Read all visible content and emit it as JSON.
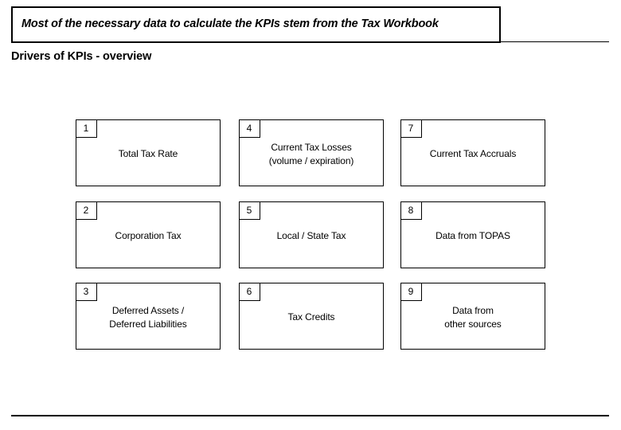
{
  "slide": {
    "title": "Most of the necessary data to calculate the KPIs stem from the Tax Workbook",
    "subtitle": "Drivers of KPIs - overview"
  },
  "grid": {
    "columns": 3,
    "rows": 3,
    "boxes": [
      {
        "number": "1",
        "label": "Total Tax Rate",
        "column": 1,
        "row": 1
      },
      {
        "number": "2",
        "label": "Corporation Tax",
        "column": 1,
        "row": 2
      },
      {
        "number": "3",
        "label": "Deferred Assets /\nDeferred Liabilities",
        "column": 1,
        "row": 3
      },
      {
        "number": "4",
        "label": "Current Tax Losses\n(volume / expiration)",
        "column": 2,
        "row": 1
      },
      {
        "number": "5",
        "label": "Local / State Tax",
        "column": 2,
        "row": 2
      },
      {
        "number": "6",
        "label": "Tax Credits",
        "column": 2,
        "row": 3
      },
      {
        "number": "7",
        "label": "Current Tax Accruals",
        "column": 3,
        "row": 1
      },
      {
        "number": "8",
        "label": "Data from TOPAS",
        "column": 3,
        "row": 2
      },
      {
        "number": "9",
        "label": "Data from\nother sources",
        "column": 3,
        "row": 3
      }
    ]
  },
  "colors": {
    "background": "#ffffff",
    "foreground": "#000000",
    "border": "#000000"
  }
}
